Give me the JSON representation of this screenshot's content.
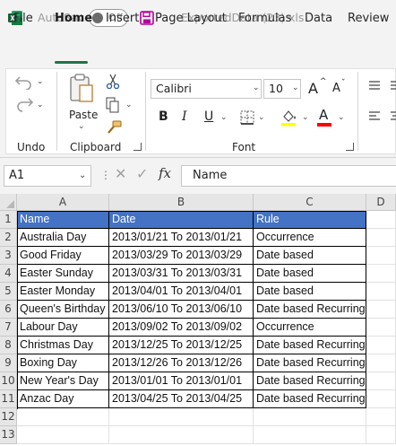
{
  "titlebar": {
    "autosave_label": "AutoSave",
    "autosave_state": "Off",
    "filename": "ExportedData (23).xls",
    "filename_chevron": "⌄"
  },
  "tabs": [
    "File",
    "Home",
    "Insert",
    "Page Layout",
    "Formulas",
    "Data",
    "Review"
  ],
  "ribbon": {
    "undo_group_label": "Undo",
    "clipboard_group_label": "Clipboard",
    "paste_label": "Paste",
    "font_group_label": "Font",
    "font_name": "Calibri",
    "font_size": "10",
    "bold": "B",
    "italic": "I",
    "underline": "U",
    "grow_font": "A",
    "shrink_font": "A",
    "font_color_glyph": "A"
  },
  "formula_bar": {
    "name_box": "A1",
    "fx": "fx",
    "content": "Name"
  },
  "columns": [
    "A",
    "B",
    "C",
    "D"
  ],
  "rows": [
    "1",
    "2",
    "3",
    "4",
    "5",
    "6",
    "7",
    "8",
    "9",
    "10",
    "11",
    "12",
    "13"
  ],
  "table": {
    "headers": [
      "Name",
      "Date",
      "Rule"
    ],
    "rows": [
      [
        "Australia Day",
        "2013/01/21 To 2013/01/21",
        "Occurrence"
      ],
      [
        "Good Friday",
        "2013/03/29 To 2013/03/29",
        "Date based"
      ],
      [
        "Easter Sunday",
        "2013/03/31 To 2013/03/31",
        "Date based"
      ],
      [
        "Easter Monday",
        "2013/04/01 To 2013/04/01",
        "Date based"
      ],
      [
        "Queen's Birthday",
        "2013/06/10 To 2013/06/10",
        "Date based Recurring"
      ],
      [
        "Labour Day",
        "2013/09/02 To 2013/09/02",
        "Occurrence"
      ],
      [
        "Christmas Day",
        "2013/12/25 To 2013/12/25",
        "Date based Recurring"
      ],
      [
        "Boxing Day",
        "2013/12/26 To 2013/12/26",
        "Date based Recurring"
      ],
      [
        "New Year's Day",
        "2013/01/01 To 2013/01/01",
        "Date based Recurring"
      ],
      [
        "Anzac Day",
        "2013/04/25 To 2013/04/25",
        "Date based Recurring"
      ]
    ]
  },
  "colors": {
    "excel_green": "#217346",
    "header_fill": "#4472c4",
    "save_icon": "#b4009e",
    "fill_yellow": "#ffff00",
    "font_red": "#ff0000"
  }
}
